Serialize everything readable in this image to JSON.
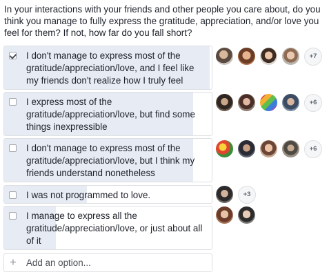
{
  "question": "In your interactions with your friends and other people you care about, do you think you manage to fully express the gratitude, appreciation, and/or love you feel for them? If not, how far do you fall short?",
  "options": [
    {
      "label": "I don't manage to express most of the gratitude/appreciation/love, and I feel like my friends don't realize how I truly feel",
      "checked": true,
      "vote_share": 0.99,
      "more_count": "+7",
      "voter_avatars": [
        "avatar-photo",
        "avatar-photo",
        "avatar-photo",
        "avatar-photo"
      ]
    },
    {
      "label": "I express most of the gratitude/appreciation/love, but find some things inexpressible",
      "checked": false,
      "vote_share": 0.91,
      "more_count": "+6",
      "voter_avatars": [
        "avatar-photo",
        "avatar-photo",
        "avatar-photo",
        "avatar-photo"
      ]
    },
    {
      "label": "I don't manage to express most of the gratitude/appreciation/love, but I think my friends understand nonetheless",
      "checked": false,
      "vote_share": 0.91,
      "more_count": "+6",
      "voter_avatars": [
        "avatar-photo",
        "avatar-photo",
        "avatar-photo",
        "avatar-photo"
      ]
    },
    {
      "label": "I was not programmed to love.",
      "checked": false,
      "vote_share": 0.4,
      "more_count": "+3",
      "voter_avatars": [
        "avatar-photo"
      ]
    },
    {
      "label": "I manage to express all the gratitude/appreciation/love, or just about all of it",
      "checked": false,
      "vote_share": 0.25,
      "more_count": "",
      "voter_avatars": [
        "avatar-photo",
        "avatar-photo"
      ]
    }
  ],
  "add_option": {
    "icon": "plus-icon",
    "placeholder": "Add an option..."
  },
  "colors": {
    "bar_fill": "#e7ebf3",
    "border": "#dddfe2",
    "text": "#1d2129"
  }
}
